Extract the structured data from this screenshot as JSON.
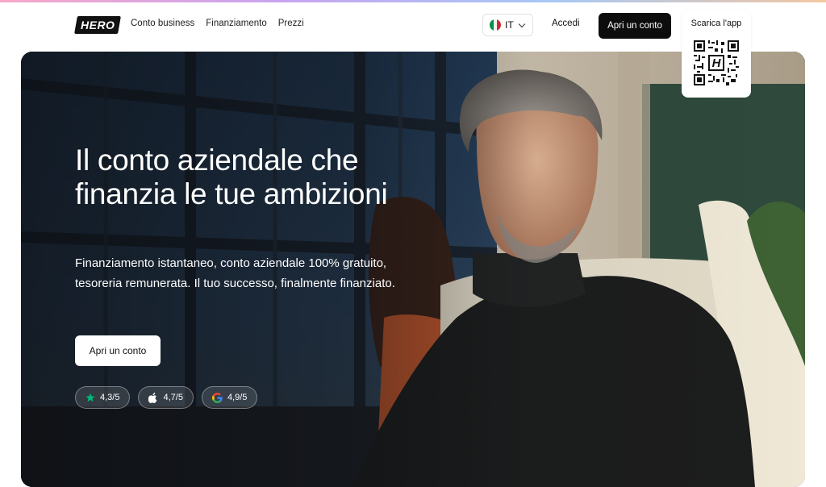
{
  "brand": {
    "logo_text": "HERO"
  },
  "nav": {
    "items": [
      {
        "label": "Conto business"
      },
      {
        "label": "Finanziamento"
      },
      {
        "label": "Prezzi"
      }
    ]
  },
  "language": {
    "code": "IT"
  },
  "header": {
    "login_label": "Accedi",
    "cta_label": "Apri un conto",
    "app_label": "Scarica l'app"
  },
  "hero": {
    "headline": "Il conto aziendale che finanzia le tue ambizioni",
    "subtitle": "Finanziamento istantaneo, conto aziendale 100% gratuito, tesoreria remunerata. Il tuo successo, finalmente finanziato.",
    "cta_label": "Apri un conto",
    "ratings": [
      {
        "icon": "trustpilot-star-icon",
        "value": "4,3/5"
      },
      {
        "icon": "apple-icon",
        "value": "4,7/5"
      },
      {
        "icon": "google-icon",
        "value": "4,9/5"
      }
    ]
  },
  "colors": {
    "accent_dark": "#0d0d0d",
    "trustpilot_green": "#00b67a",
    "flag_green": "#009246",
    "flag_red": "#ce2b37"
  }
}
